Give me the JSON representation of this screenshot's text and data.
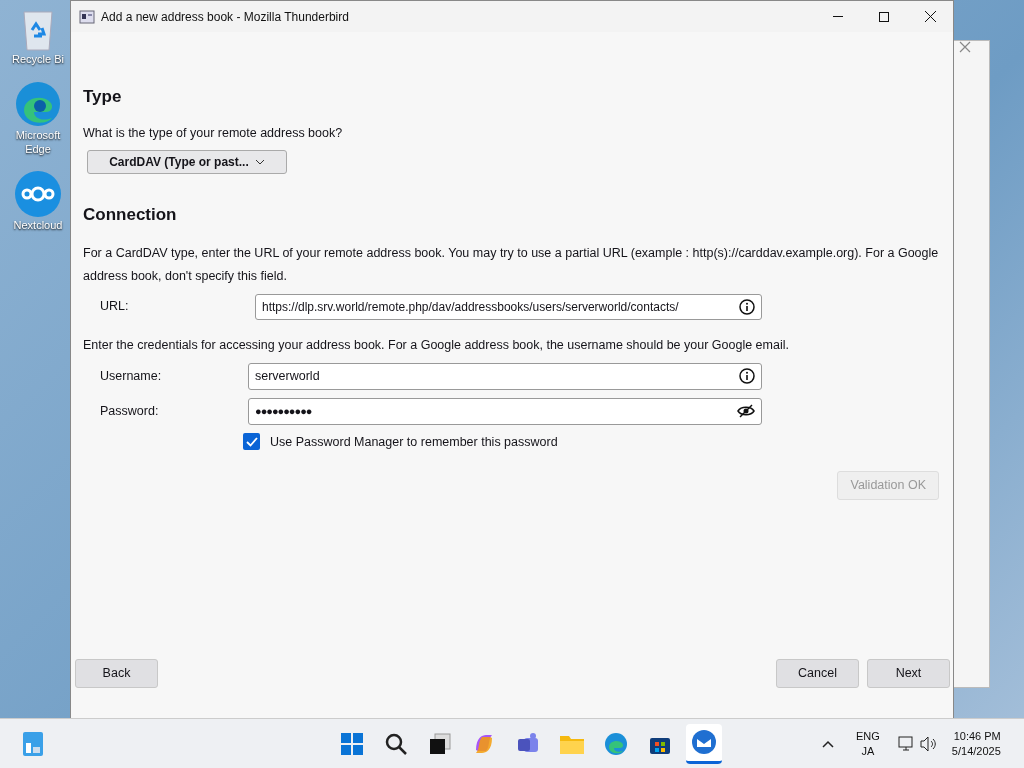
{
  "desktop_icons": [
    {
      "kind": "recycle",
      "label": "Recycle Bi"
    },
    {
      "kind": "edge",
      "label": "Microsoft Edge"
    },
    {
      "kind": "nextcloud",
      "label": "Nextcloud"
    }
  ],
  "window": {
    "title": "Add a new address book - Mozilla Thunderbird"
  },
  "type_section": {
    "heading": "Type",
    "question": "What is the type of your remote address book?",
    "dropdown": "CardDAV (Type or past..."
  },
  "connection_section": {
    "heading": "Connection",
    "description": "For a CardDAV type, enter the URL of your remote address book. You may try to use a partial URL (example : http(s)://carddav.example.org). For a Google address book, don't specify this field.",
    "url_label": "URL:",
    "url_value": "https://dlp.srv.world/remote.php/dav/addressbooks/users/serverworld/contacts/",
    "credentials_text": "Enter the credentials for accessing your address book. For a Google address book, the username should be your Google email.",
    "username_label": "Username:",
    "username_value": "serverworld",
    "password_label": "Password:",
    "password_value": "●●●●●●●●●●",
    "remember": {
      "label": "Use Password Manager to remember this password",
      "checked": true
    },
    "validate_button": {
      "label": "Validation OK",
      "disabled": true
    }
  },
  "footer_buttons": {
    "back": "Back",
    "cancel": "Cancel",
    "next": "Next"
  },
  "taskbar": {
    "apps": [
      {
        "kind": "start",
        "selected": false
      },
      {
        "kind": "search",
        "selected": false
      },
      {
        "kind": "taskview",
        "selected": false
      },
      {
        "kind": "copilot",
        "selected": false
      },
      {
        "kind": "teams",
        "selected": false
      },
      {
        "kind": "explorer",
        "selected": false
      },
      {
        "kind": "edge",
        "selected": false
      },
      {
        "kind": "store",
        "selected": false
      },
      {
        "kind": "thunderbird",
        "selected": true
      }
    ],
    "lang_top": "ENG",
    "lang_bottom": "JA",
    "time": "10:46 PM",
    "date": "5/14/2025"
  }
}
